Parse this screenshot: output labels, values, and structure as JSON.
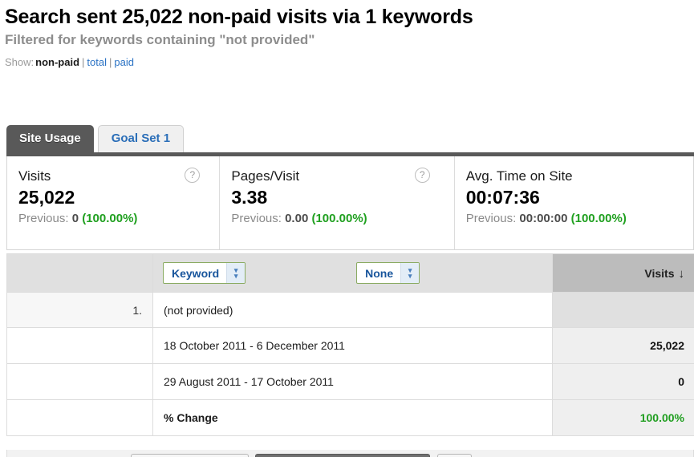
{
  "header": {
    "title": "Search sent 25,022 non-paid visits via 1 keywords",
    "subtitle": "Filtered for keywords containing \"not provided\"",
    "show_label": "Show:",
    "show_current": "non-paid",
    "separator": "|",
    "show_total_link": "total",
    "show_paid_link": "paid"
  },
  "tabs": [
    {
      "label": "Site Usage",
      "active": true
    },
    {
      "label": "Goal Set 1",
      "active": false
    }
  ],
  "metrics": [
    {
      "name": "Visits",
      "value": "25,022",
      "previous_label": "Previous:",
      "previous_value": "0",
      "delta": "(100.00%)",
      "help_icon": "question-mark-icon"
    },
    {
      "name": "Pages/Visit",
      "value": "3.38",
      "previous_label": "Previous:",
      "previous_value": "0.00",
      "delta": "(100.00%)",
      "help_icon": "question-mark-icon"
    },
    {
      "name": "Avg. Time on Site",
      "value": "00:07:36",
      "previous_label": "Previous:",
      "previous_value": "00:00:00",
      "delta": "(100.00%)",
      "help_icon": "question-mark-icon"
    }
  ],
  "table": {
    "primary_dimension": "Keyword",
    "secondary_dimension": "None",
    "metric_column": "Visits",
    "sort_arrow": "↓",
    "rows": [
      {
        "index": "1.",
        "label": "(not provided)",
        "value": ""
      },
      {
        "index": "",
        "label": "18 October 2011 - 6 December 2011",
        "value": "25,022"
      },
      {
        "index": "",
        "label": "29 August 2011 - 17 October 2011",
        "value": "0"
      },
      {
        "index": "",
        "label": "% Change",
        "value": "100.00%"
      }
    ]
  },
  "colors": {
    "link_blue": "#2a72c4",
    "positive_green": "#20a020",
    "active_tab_bg": "#595959",
    "dropdown_border_green": "#8aab62",
    "dropdown_text_blue": "#18559c"
  }
}
